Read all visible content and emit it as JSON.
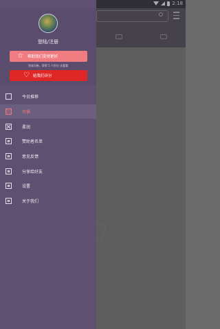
{
  "status_bar": {
    "time": "2:18",
    "icons": [
      "notification-icon",
      "wifi-icon",
      "signal-icon",
      "battery-icon"
    ]
  },
  "drawer": {
    "header": {
      "avatar": "avatar-icon",
      "login_label": "登陆/注册",
      "prefs_button_label": "帮助我们变得更好",
      "hint_text": "完成问卷，获得 5 个积分 去看看",
      "rate_button_label": "给我们评分"
    },
    "menu": [
      {
        "label": "今日推荐",
        "icon": "square-icon",
        "selected": false
      },
      {
        "label": "吊桶",
        "icon": "bucket-icon",
        "selected": true
      },
      {
        "label": "柔润",
        "icon": "x-icon",
        "selected": false
      },
      {
        "label": "赞助者名单",
        "icon": "square-dot-icon",
        "selected": false
      },
      {
        "label": "意见反馈",
        "icon": "square-dot-icon",
        "selected": false
      },
      {
        "label": "分享给好友",
        "icon": "share-icon",
        "selected": false
      },
      {
        "label": "设置",
        "icon": "settings-icon",
        "selected": false
      },
      {
        "label": "关于我们",
        "icon": "info-icon",
        "selected": false
      }
    ]
  },
  "colors": {
    "drawer_bg": "#5d5070",
    "prefs_button": "#f07c82",
    "rate_button": "#e02727",
    "selected_text": "#f0797e",
    "app_bg": "#6b6b6b"
  }
}
